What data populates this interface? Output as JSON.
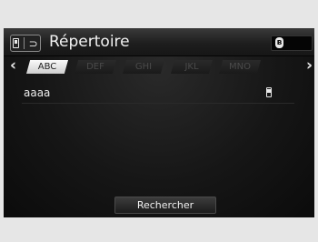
{
  "header": {
    "title": "Répertoire",
    "left_icon": "phone-back-icon",
    "right_icon": "bluetooth-icon"
  },
  "tabs": {
    "prev_arrow": "‹",
    "next_arrow": "›",
    "items": [
      {
        "label": "ABC",
        "active": true
      },
      {
        "label": "DEF",
        "active": false
      },
      {
        "label": "GHI",
        "active": false
      },
      {
        "label": "JKL",
        "active": false
      },
      {
        "label": "MNO",
        "active": false
      }
    ]
  },
  "contacts": [
    {
      "name": "aaaa",
      "icon": "mobile-phone-icon"
    }
  ],
  "search_button": {
    "label": "Rechercher"
  },
  "colors": {
    "background": "#e6e6e6",
    "screen": "#161616",
    "active_tab": "#f2f2f2",
    "text": "#f2f2f2"
  }
}
